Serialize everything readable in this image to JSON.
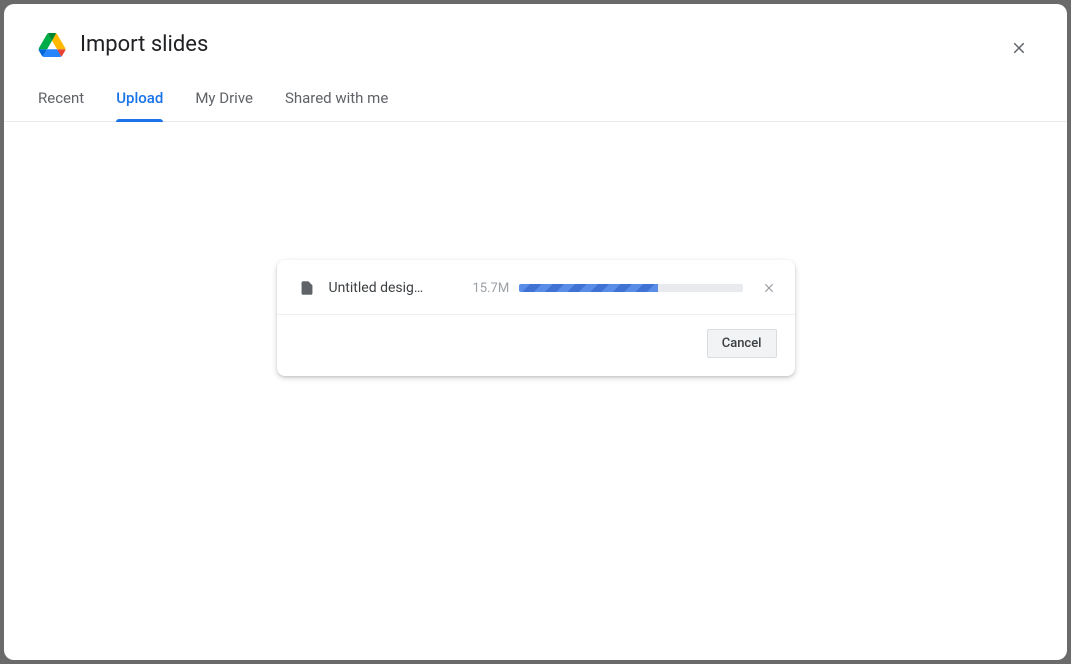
{
  "dialog": {
    "title": "Import slides"
  },
  "tabs": [
    {
      "label": "Recent",
      "active": false
    },
    {
      "label": "Upload",
      "active": true
    },
    {
      "label": "My Drive",
      "active": false
    },
    {
      "label": "Shared with me",
      "active": false
    }
  ],
  "upload": {
    "file_name": "Untitled desig…",
    "file_size": "15.7M",
    "progress_percent": 62,
    "cancel_label": "Cancel"
  }
}
